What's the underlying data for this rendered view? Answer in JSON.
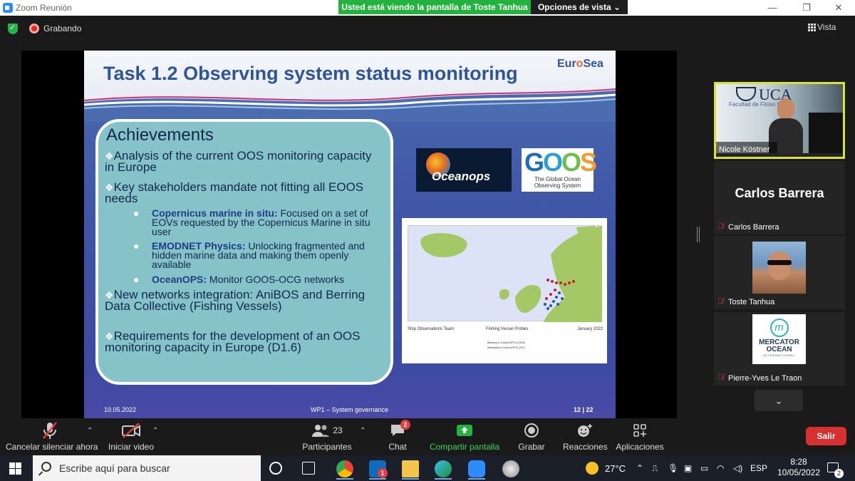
{
  "window": {
    "title": "Zoom Reunión",
    "share_banner": "Usted está viendo la pantalla de Toste Tanhua",
    "view_options": "Opciones de vista",
    "minimize": "—",
    "restore": "❐",
    "close": "✕"
  },
  "meeting_bar": {
    "recording": "Grabando",
    "view": "Vista"
  },
  "slide": {
    "title": "Task 1.2 Observing system status monitoring",
    "logo_left": "Eur",
    "logo_o": "o",
    "logo_right": "Sea",
    "achievements_title": "Achievements",
    "bullets": [
      "Analysis of the current OOS monitoring capacity in Europe",
      "Key stakeholders mandate not fitting all EOOS needs",
      "New networks integration: AniBOS and Berring Data Collective (Fishing Vessels)",
      "Requirements for the development of an OOS monitoring capacity in Europe (D1.6)"
    ],
    "sub_bullets": [
      {
        "bold": "Copernicus marine in situ:",
        "text": " Focused on a set of EOVs requested by the Copernicus Marine in situ user"
      },
      {
        "bold": "EMODNET Physics:",
        "text": " Unlocking fragmented and hidden marine data and making them openly available"
      },
      {
        "bold": "OceanOPS:",
        "text": " Monitor GOOS-OCG networks"
      }
    ],
    "oceanops_logo": "Oceanops",
    "goos_letters": [
      "G",
      "O",
      "O",
      "S"
    ],
    "goos_caption_1": "The Global Ocean",
    "goos_caption_2": "Observing System",
    "map_caption_left": "Ship Observations Team",
    "map_caption_center": "Fishing Vessel Probes",
    "map_caption_right": "January 2022",
    "map_legend_1": "Missing in OceanOPS (3,026)",
    "map_legend_2": "Metadata in OceanOPS (237)",
    "footer_date": "10.05.2022",
    "footer_center": "WP1 – System governance",
    "footer_page": "12 | 22"
  },
  "participants": [
    {
      "name": "Nicole Köstner",
      "active": true
    },
    {
      "name": "Carlos Barrera",
      "display": "Carlos Barrera",
      "muted": true
    },
    {
      "name": "Toste Tanhua",
      "muted": true
    },
    {
      "name": "Pierre-Yves Le Traon",
      "muted": true
    }
  ],
  "nicole_bg": {
    "uca": "UCA",
    "faculty": "Facultad de Filoso     tras"
  },
  "mercator": {
    "title_1": "MERCATOR",
    "title_2": "OCEAN",
    "sub": "INTERNATIONAL",
    "m": "m"
  },
  "toolbar": {
    "mute": "Cancelar silenciar ahora",
    "video": "Iniciar video",
    "participants": "Participantes",
    "participants_count": "23",
    "chat": "Chat",
    "chat_badge": "2",
    "share": "Compartir pantalla",
    "record": "Grabar",
    "reactions": "Reacciones",
    "apps": "Aplicaciones",
    "leave": "Salir"
  },
  "taskbar": {
    "search_placeholder": "Escribe aquí para buscar",
    "mail_badge": "1",
    "temperature": "27°C",
    "language": "ESP",
    "time": "8:28",
    "date": "10/05/2022",
    "notifications": "2"
  },
  "colors": {
    "share_green": "#24b23e",
    "leave_red": "#d82f2f",
    "active_speaker": "#d6e23a",
    "slide_title": "#2f5597"
  }
}
